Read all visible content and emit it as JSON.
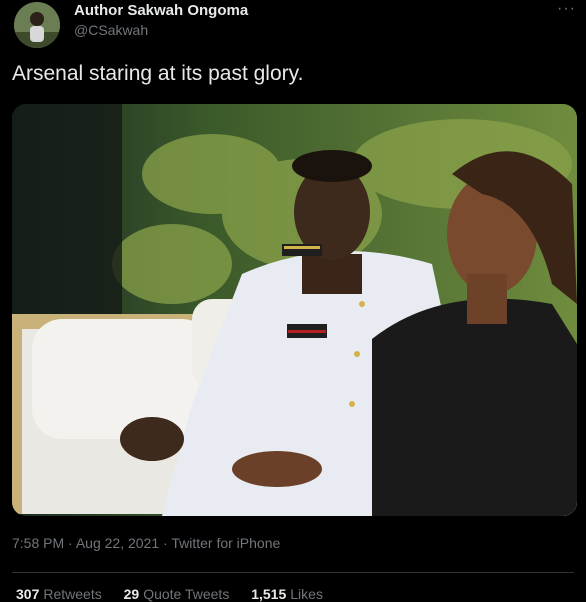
{
  "author": {
    "display_name": "Author Sakwah Ongoma",
    "handle": "@CSakwah"
  },
  "menu": {
    "more_label": "···"
  },
  "tweet": {
    "text": "Arsenal staring at its past glory."
  },
  "meta": {
    "time": "7:58 PM",
    "separator": "·",
    "date": "Aug 22, 2021",
    "source": "Twitter for iPhone"
  },
  "stats": [
    {
      "count": "307",
      "label": "Retweets"
    },
    {
      "count": "29",
      "label": "Quote Tweets"
    },
    {
      "count": "1,515",
      "label": "Likes"
    }
  ],
  "colors": {
    "background": "#000000",
    "text": "#e7e9ea",
    "secondary": "#71767b",
    "divider": "#2f3336"
  }
}
